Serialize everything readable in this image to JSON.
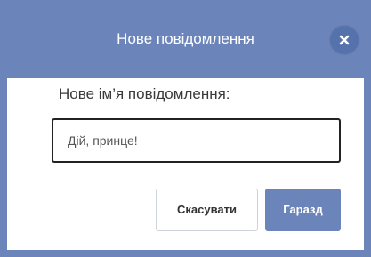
{
  "dialog": {
    "title": "Нове повідомлення",
    "close_icon": "close-icon",
    "prompt": "Нове ім’я повідомлення:",
    "input_value": "Дій, принце!",
    "cancel_label": "Скасувати",
    "ok_label": "Гаразд"
  },
  "colors": {
    "header": "#6b84b9",
    "close_button": "#5672ad",
    "ok_button": "#6b84b9",
    "input_border": "#222222"
  }
}
